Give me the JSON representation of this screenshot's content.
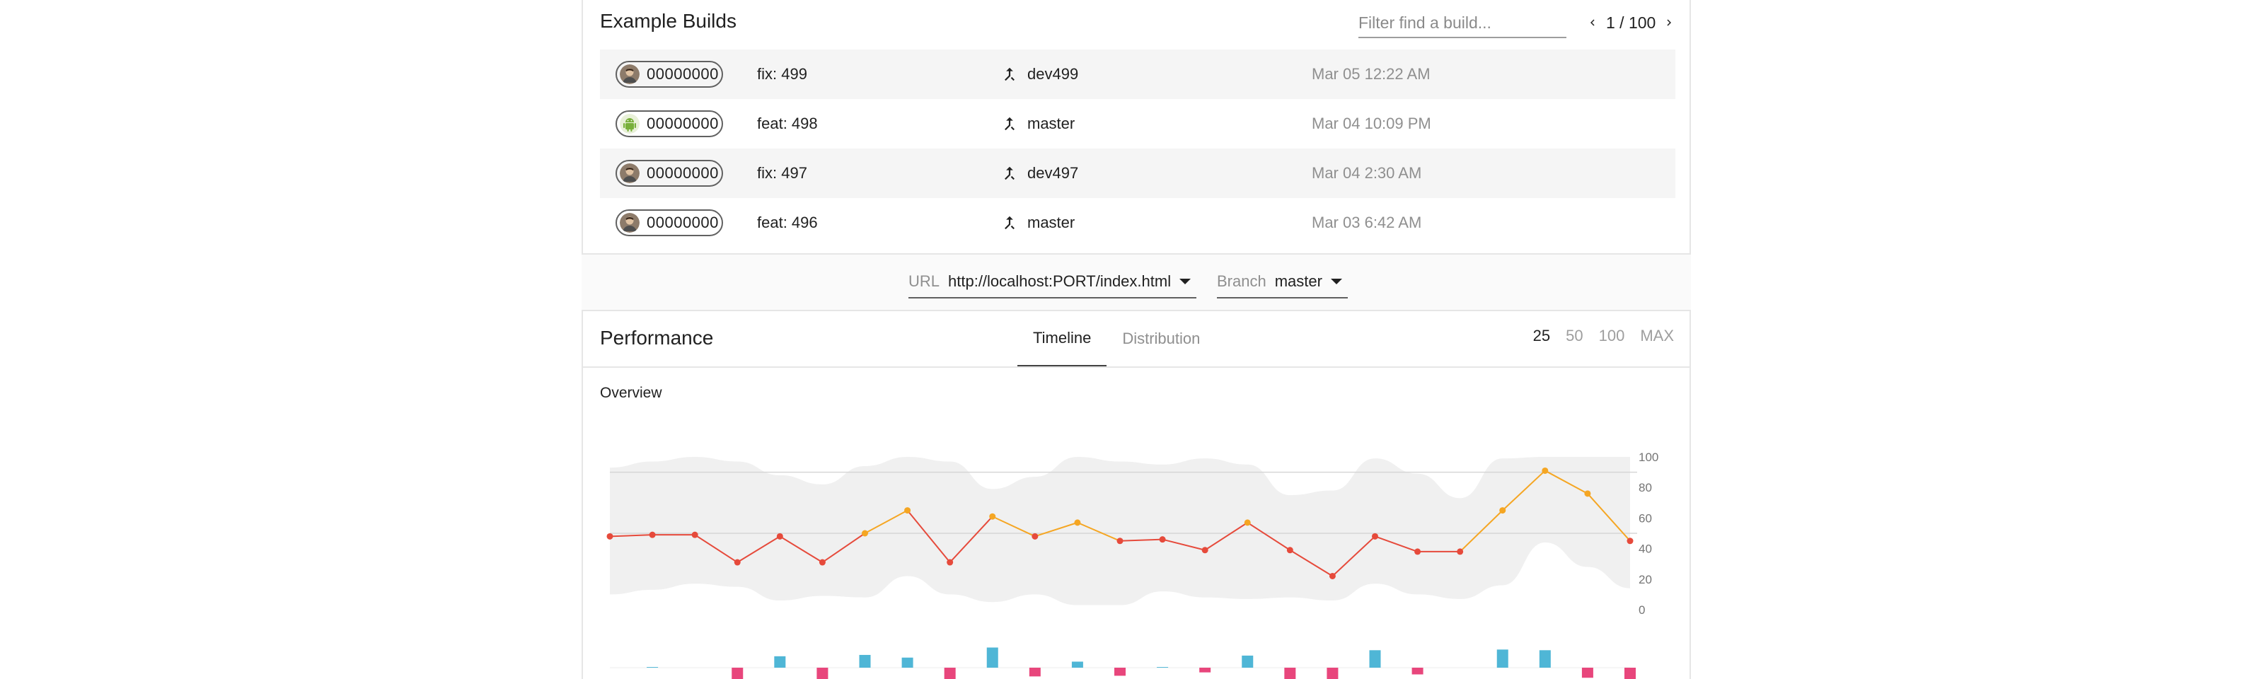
{
  "builds": {
    "title": "Example Builds",
    "filter_placeholder": "Filter find a build...",
    "pager_text": "1 / 100",
    "rows": [
      {
        "hash": "00000000",
        "message": "fix: 499",
        "branch": "dev499",
        "time": "Mar 05 12:22 AM",
        "avatar": "person"
      },
      {
        "hash": "00000000",
        "message": "feat: 498",
        "branch": "master",
        "time": "Mar 04 10:09 PM",
        "avatar": "android"
      },
      {
        "hash": "00000000",
        "message": "fix: 497",
        "branch": "dev497",
        "time": "Mar 04 2:30 AM",
        "avatar": "person"
      },
      {
        "hash": "00000000",
        "message": "feat: 496",
        "branch": "master",
        "time": "Mar 03 6:42 AM",
        "avatar": "person"
      }
    ]
  },
  "selectors": {
    "url_label": "URL",
    "url_value": "http://localhost:PORT/index.html",
    "branch_label": "Branch",
    "branch_value": "master"
  },
  "performance": {
    "title": "Performance",
    "tabs": [
      {
        "label": "Timeline",
        "active": true
      },
      {
        "label": "Distribution",
        "active": false
      }
    ],
    "ranges": [
      {
        "label": "25",
        "active": true
      },
      {
        "label": "50",
        "active": false
      },
      {
        "label": "100",
        "active": false
      },
      {
        "label": "MAX",
        "active": false
      }
    ],
    "overview_label": "Overview"
  },
  "chart_data": {
    "type": "line",
    "ylim": [
      0,
      100
    ],
    "y_ticks": [
      "100",
      "80",
      "60",
      "40",
      "20",
      "0"
    ],
    "gridlines_at": [
      90,
      50
    ],
    "colors": {
      "low": "#e64a3b",
      "high": "#f5a623",
      "band": "#f0f0f0",
      "delta_up": "#4fb6d6",
      "delta_down": "#e8467c"
    },
    "series": [
      {
        "values": [
          48,
          49,
          49,
          31,
          48,
          31,
          50,
          65,
          31,
          61,
          48,
          57,
          45,
          46,
          39,
          57,
          39,
          22,
          48,
          38,
          38,
          65,
          91,
          76,
          45
        ]
      }
    ],
    "band_upper": [
      93,
      97,
      100,
      97,
      88,
      82,
      94,
      100,
      97,
      79,
      87,
      100,
      97,
      95,
      99,
      95,
      75,
      78,
      99,
      89,
      73,
      99,
      100,
      100,
      100
    ],
    "band_lower": [
      10,
      13,
      17,
      15,
      6,
      9,
      8,
      22,
      10,
      5,
      10,
      3,
      3,
      12,
      8,
      7,
      8,
      6,
      17,
      10,
      7,
      16,
      44,
      28,
      14
    ],
    "deltas": [
      0,
      1,
      0,
      -18,
      17,
      -17,
      19,
      15,
      -34,
      30,
      -13,
      9,
      -12,
      1,
      -7,
      18,
      -18,
      -17,
      26,
      -10,
      0,
      27,
      26,
      -15,
      -31
    ]
  }
}
